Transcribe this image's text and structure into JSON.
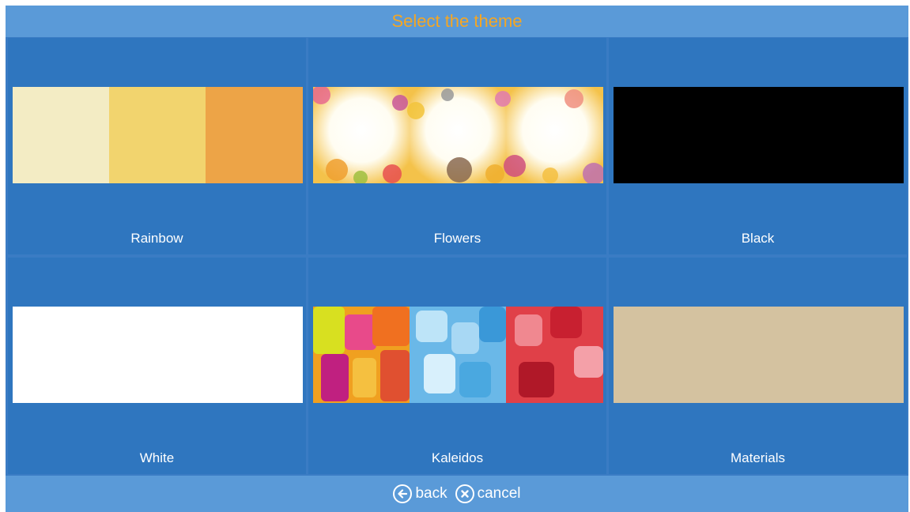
{
  "header": {
    "title": "Select the theme"
  },
  "themes": [
    {
      "label": "Rainbow"
    },
    {
      "label": "Flowers"
    },
    {
      "label": "Black"
    },
    {
      "label": "White"
    },
    {
      "label": "Kaleidos"
    },
    {
      "label": "Materials"
    }
  ],
  "footer": {
    "back_label": "back",
    "cancel_label": "cancel"
  },
  "colors": {
    "accent": "#f5a623",
    "tile_bg": "#2f76bf",
    "bar_bg": "#5a9ad8"
  }
}
